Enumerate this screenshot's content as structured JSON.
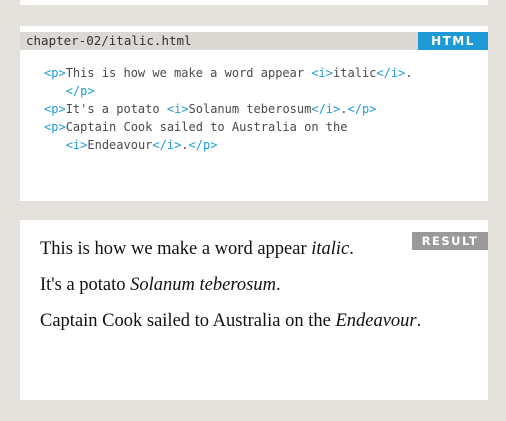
{
  "code_panel": {
    "filename": "chapter-02/italic.html",
    "language": "HTML",
    "lines": [
      [
        [
          "tag",
          "<p>"
        ],
        [
          "txt",
          "This is how we make a word appear "
        ],
        [
          "tag",
          "<i>"
        ],
        [
          "txt",
          "italic"
        ],
        [
          "tag",
          "</i>"
        ],
        [
          "txt",
          "."
        ]
      ],
      [
        [
          "txt",
          "   "
        ],
        [
          "tag",
          "</p>"
        ]
      ],
      [
        [
          "tag",
          "<p>"
        ],
        [
          "txt",
          "It's a potato "
        ],
        [
          "tag",
          "<i>"
        ],
        [
          "txt",
          "Solanum teberosum"
        ],
        [
          "tag",
          "</i>"
        ],
        [
          "txt",
          "."
        ],
        [
          "tag",
          "</p>"
        ]
      ],
      [
        [
          "tag",
          "<p>"
        ],
        [
          "txt",
          "Captain Cook sailed to Australia on the"
        ]
      ],
      [
        [
          "txt",
          "   "
        ],
        [
          "tag",
          "<i>"
        ],
        [
          "txt",
          "Endeavour"
        ],
        [
          "tag",
          "</i>"
        ],
        [
          "txt",
          "."
        ],
        [
          "tag",
          "</p>"
        ]
      ]
    ]
  },
  "result_panel": {
    "label": "RESULT",
    "lines": [
      [
        [
          "n",
          "This is how we make a word appear "
        ],
        [
          "i",
          "italic"
        ],
        [
          "n",
          "."
        ]
      ],
      [
        [
          "n",
          "It's a potato "
        ],
        [
          "i",
          "Solanum teberosum"
        ],
        [
          "n",
          "."
        ]
      ],
      [
        [
          "n",
          "Captain Cook sailed to Australia on the "
        ],
        [
          "i",
          "Endeavour"
        ],
        [
          "n",
          "."
        ]
      ]
    ]
  }
}
